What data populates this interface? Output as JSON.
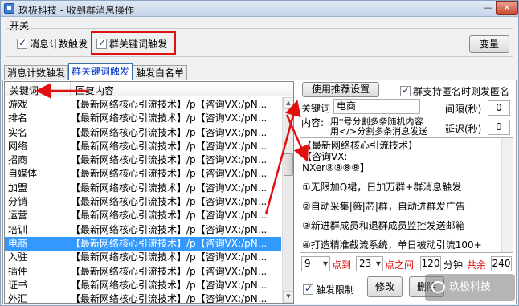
{
  "window": {
    "title": "玖极科技 - 收到群消息操作",
    "minimize": "—",
    "close": "✕"
  },
  "switch_group": {
    "label": "开关",
    "msg_count_trigger": {
      "label": "消息计数触发",
      "checked": true
    },
    "keyword_trigger": {
      "label": "群关键词触发",
      "checked": true
    },
    "variables_button": "变量"
  },
  "tabs": [
    "消息计数触发",
    "群关键词触发",
    "触发白名单"
  ],
  "keyword_table": {
    "headers": [
      "关键词",
      "回复内容"
    ],
    "rows": [
      {
        "keyword": "游戏",
        "reply": "【最新网络核心引流技术】/p【咨询VX:/pN..."
      },
      {
        "keyword": "排名",
        "reply": "【最新网络核心引流技术】/p【咨询VX:/pN..."
      },
      {
        "keyword": "实名",
        "reply": "【最新网络核心引流技术】/p【咨询VX:/pN..."
      },
      {
        "keyword": "网络",
        "reply": "【最新网络核心引流技术】/p【咨询VX:/pN..."
      },
      {
        "keyword": "招商",
        "reply": "【最新网络核心引流技术】/p【咨询VX:/pN..."
      },
      {
        "keyword": "自媒体",
        "reply": "【最新网络核心引流技术】/p【咨询VX:/pN..."
      },
      {
        "keyword": "加盟",
        "reply": "【最新网络核心引流技术】/p【咨询VX:/pN..."
      },
      {
        "keyword": "分销",
        "reply": "【最新网络核心引流技术】/p【咨询VX:/pN..."
      },
      {
        "keyword": "运营",
        "reply": "【最新网络核心引流技术】/p【咨询VX:/pN..."
      },
      {
        "keyword": "培训",
        "reply": "【最新网络核心引流技术】/p【咨询VX:/pN..."
      },
      {
        "keyword": "电商",
        "reply": "【最新网络核心引流技术】/p【咨询VX:/pN..."
      },
      {
        "keyword": "入驻",
        "reply": "【最新网络核心引流技术】/p【咨询VX:/pN..."
      },
      {
        "keyword": "插件",
        "reply": "【最新网络核心引流技术】/p【咨询VX:/pN..."
      },
      {
        "keyword": "证书",
        "reply": "【最新网络核心引流技术】/p【咨询VX:/pN..."
      },
      {
        "keyword": "外汇",
        "reply": "【最新网络核心引流技术】/p【咨询VX:/pN..."
      }
    ],
    "selected_index": 10
  },
  "right_panel": {
    "use_recommended_button": "使用推荐设置",
    "anonymous_checkbox": {
      "label": "群支持匿名时则发匿名",
      "checked": true
    },
    "keyword_label": "关键词",
    "keyword_value": "电商",
    "content_label": "内容:",
    "content_hint_1": "用*号分割多条随机内容",
    "content_hint_2": "用</>分割多条消息发送",
    "interval_label": "间隔(秒)",
    "interval_value": "0",
    "delay_label": "延迟(秒)",
    "delay_value": "0",
    "content_lines": [
      "【最新网络核心引流技术】",
      "【咨询VX:",
      "NXer⑧⑧⑧⑧】",
      "",
      "①无限加Q裙，日加万群+群消息触发",
      "",
      "②自动采集|薇|芯|群，自动进群发广告",
      "",
      "③新进群成员和退群成员监控发送邮箱",
      "",
      "④打造精准截流系统，单日被动引流100+"
    ],
    "time_from_value": "9",
    "time_from_suffix": "点到",
    "time_to_value": "23",
    "time_to_suffix": "点之间",
    "minutes_value": "120",
    "minutes_label": "分钟",
    "total_label": "共余",
    "total_value": "240",
    "trigger_limit_checkbox": {
      "label": "触发限制",
      "checked": true
    },
    "modify_button": "修改",
    "delete_button": "删除"
  },
  "watermark": "玖极科技",
  "colors": {
    "highlight_red": "#e01010",
    "selection_blue": "#3399ff",
    "tab_active_text": "#0033cc"
  }
}
